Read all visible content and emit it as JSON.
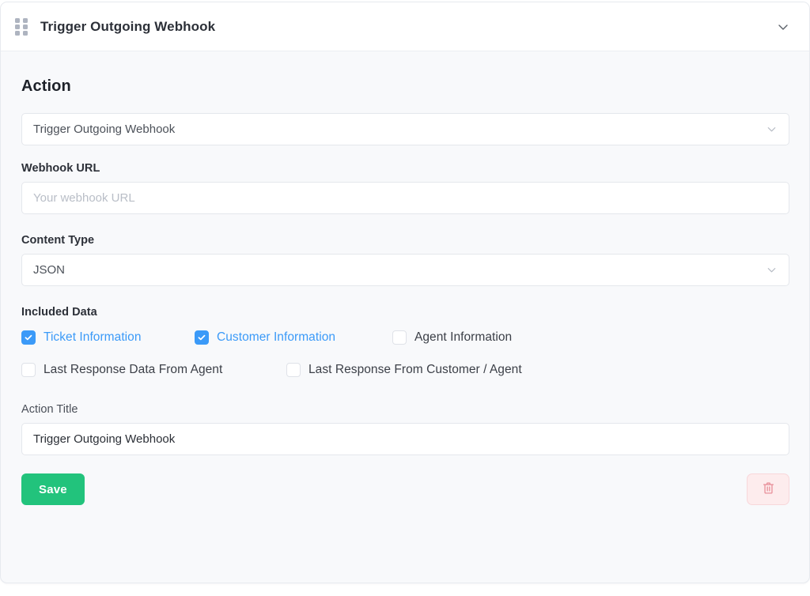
{
  "header": {
    "title": "Trigger Outgoing Webhook",
    "drag_handle_icon": "drag-handle-icon",
    "collapse_icon": "chevron-down-icon"
  },
  "section": {
    "title": "Action"
  },
  "action_select": {
    "value": "Trigger Outgoing Webhook",
    "chevron_icon": "chevron-down-icon"
  },
  "webhook_url": {
    "label": "Webhook URL",
    "value": "",
    "placeholder": "Your webhook URL"
  },
  "content_type": {
    "label": "Content Type",
    "value": "JSON",
    "chevron_icon": "chevron-down-icon"
  },
  "included_data": {
    "label": "Included Data",
    "rows": [
      [
        {
          "label": "Ticket Information",
          "checked": true
        },
        {
          "label": "Customer Information",
          "checked": true
        },
        {
          "label": "Agent Information",
          "checked": false
        }
      ],
      [
        {
          "label": "Last Response Data From Agent",
          "checked": false
        },
        {
          "label": "Last Response From Customer / Agent",
          "checked": false
        }
      ]
    ]
  },
  "action_title": {
    "label": "Action Title",
    "value": "Trigger Outgoing Webhook"
  },
  "footer": {
    "save_label": "Save",
    "delete_icon": "trash-icon"
  },
  "colors": {
    "accent_blue": "#3b9af8",
    "save_green": "#22c37c",
    "delete_red": "#e8919b",
    "delete_bg": "#fdeced",
    "body_bg": "#f8f9fb",
    "text_dark": "#2c3038"
  }
}
